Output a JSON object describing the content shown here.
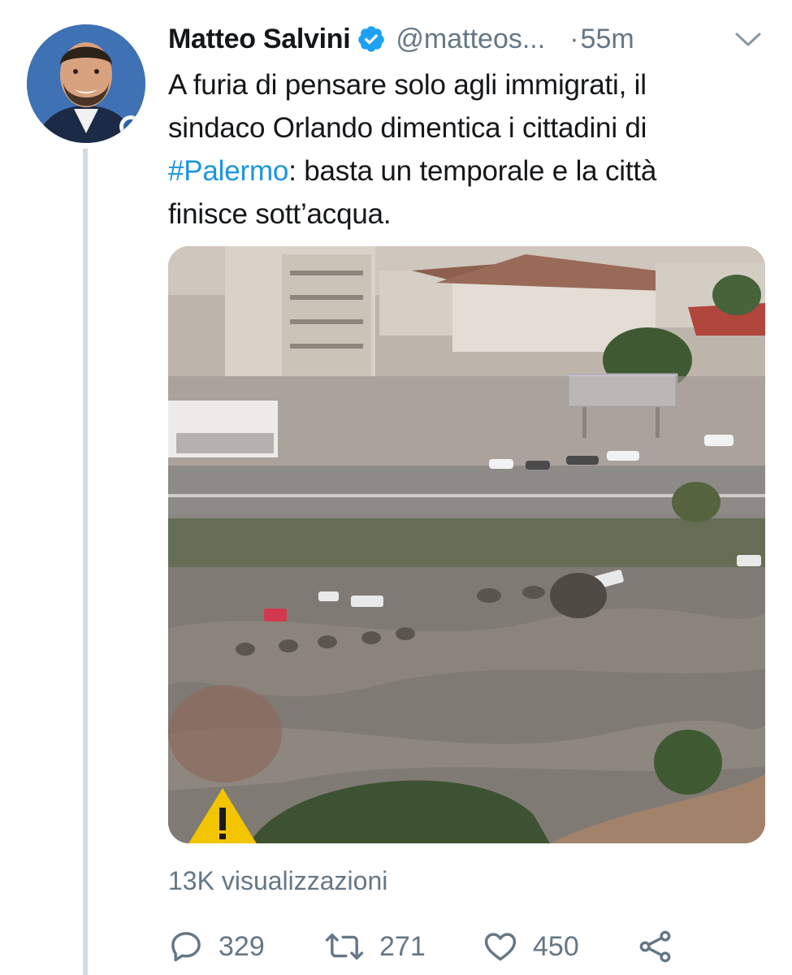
{
  "tweet": {
    "author": {
      "name": "Matteo Salvini",
      "handle": "@matteos...",
      "verified": true,
      "avatar_icon": "avatar-portrait"
    },
    "separator": "·",
    "time": "55m",
    "text_lines": [
      "A furia di pensare solo agli immigrati, il",
      "sindaco Orlando dimentica i cittadini di"
    ],
    "hashtag": "#Palermo",
    "text_after_hashtag": ": basta un temporale e la città",
    "text_last_line": "finisce sott’acqua.",
    "media": {
      "description_icon": "flooded-street-video",
      "warning_icon": "warning-triangle-icon"
    },
    "views": "13K visualizzazioni",
    "actions": {
      "reply_count": "329",
      "retweet_count": "271",
      "like_count": "450"
    }
  },
  "colors": {
    "text": "#14171a",
    "secondary": "#657786",
    "link": "#1b95e0",
    "verified": "#1da1f2",
    "thread_line": "#d3dbe3"
  }
}
